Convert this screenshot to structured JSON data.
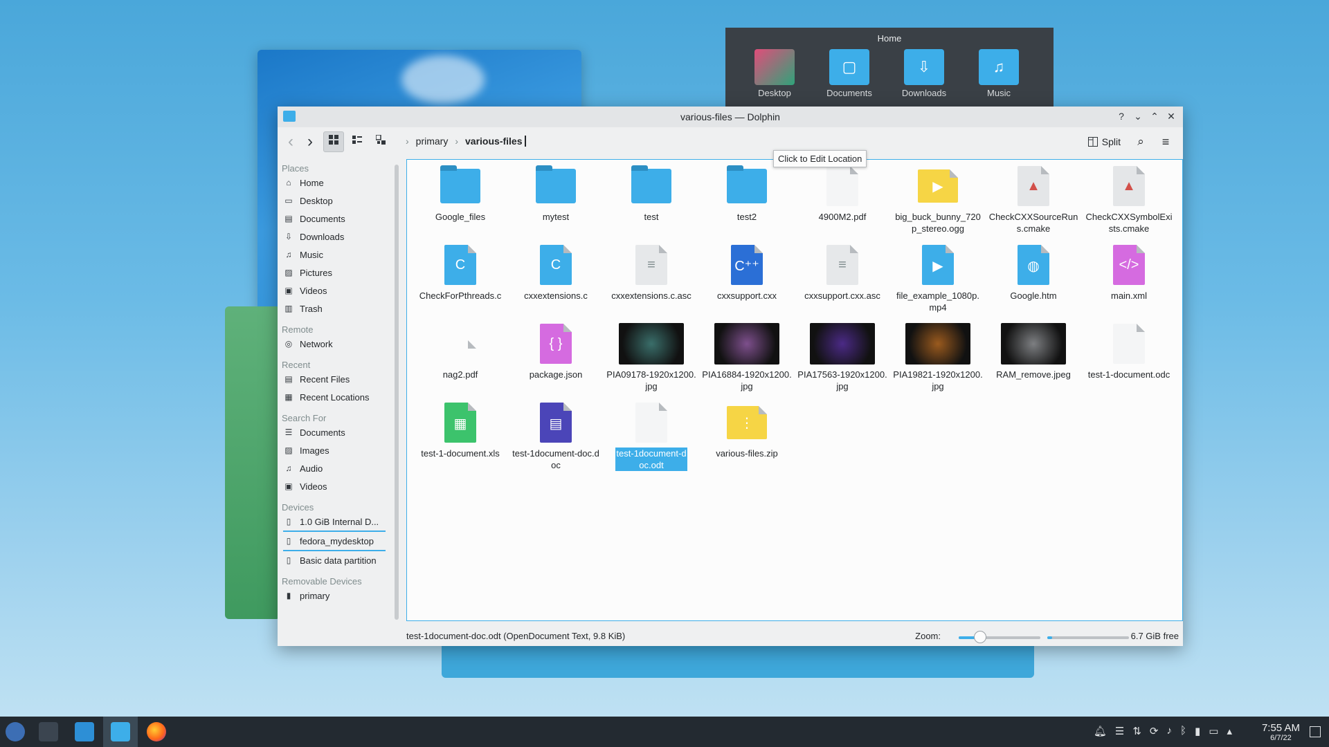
{
  "home_popup": {
    "title": "Home",
    "items": [
      {
        "label": "Desktop",
        "icon": "desktop-folder-icon"
      },
      {
        "label": "Documents",
        "icon": "documents-folder-icon"
      },
      {
        "label": "Downloads",
        "icon": "downloads-folder-icon"
      },
      {
        "label": "Music",
        "icon": "music-folder-icon"
      }
    ]
  },
  "window": {
    "title": "various-files — Dolphin",
    "controls": {
      "help": "?",
      "minimize": "⌄",
      "maximize": "⌃",
      "close": "✕"
    }
  },
  "toolbar": {
    "back": "‹",
    "forward": "›",
    "breadcrumb": [
      "primary",
      "various-files"
    ],
    "split_label": "Split",
    "tooltip": "Click to Edit Location"
  },
  "places": [
    {
      "group": "Places",
      "items": [
        {
          "label": "Home",
          "icon": "home-icon"
        },
        {
          "label": "Desktop",
          "icon": "desktop-icon"
        },
        {
          "label": "Documents",
          "icon": "documents-icon"
        },
        {
          "label": "Downloads",
          "icon": "downloads-icon"
        },
        {
          "label": "Music",
          "icon": "music-icon"
        },
        {
          "label": "Pictures",
          "icon": "pictures-icon"
        },
        {
          "label": "Videos",
          "icon": "videos-icon"
        },
        {
          "label": "Trash",
          "icon": "trash-icon"
        }
      ]
    },
    {
      "group": "Remote",
      "items": [
        {
          "label": "Network",
          "icon": "network-icon"
        }
      ]
    },
    {
      "group": "Recent",
      "items": [
        {
          "label": "Recent Files",
          "icon": "recent-files-icon"
        },
        {
          "label": "Recent Locations",
          "icon": "recent-locations-icon"
        }
      ]
    },
    {
      "group": "Search For",
      "items": [
        {
          "label": "Documents",
          "icon": "documents-search-icon"
        },
        {
          "label": "Images",
          "icon": "images-icon"
        },
        {
          "label": "Audio",
          "icon": "audio-icon"
        },
        {
          "label": "Videos",
          "icon": "videos-search-icon"
        }
      ]
    },
    {
      "group": "Devices",
      "items": [
        {
          "label": "1.0 GiB Internal D...",
          "icon": "drive-icon",
          "usage_bar": true
        },
        {
          "label": "fedora_mydesktop",
          "icon": "drive-icon",
          "usage_bar": true
        },
        {
          "label": "Basic data partition",
          "icon": "drive-locked-icon"
        }
      ]
    },
    {
      "group": "Removable Devices",
      "items": [
        {
          "label": "primary",
          "icon": "usb-drive-icon"
        }
      ]
    }
  ],
  "files": [
    {
      "name": "Google_files",
      "kind": "folder"
    },
    {
      "name": "mytest",
      "kind": "folder"
    },
    {
      "name": "test",
      "kind": "folder"
    },
    {
      "name": "test2",
      "kind": "folder"
    },
    {
      "name": "4900M2.pdf",
      "kind": "pdf"
    },
    {
      "name": "big_buck_bunny_720p_stereo.ogg",
      "kind": "audio",
      "color": "#f6d545"
    },
    {
      "name": "CheckCXXSourceRuns.cmake",
      "kind": "cmake"
    },
    {
      "name": "CheckCXXSymbolExists.cmake",
      "kind": "cmake"
    },
    {
      "name": "CheckForPthreads.c",
      "kind": "c",
      "color": "#3daee9"
    },
    {
      "name": "cxxextensions.c",
      "kind": "c",
      "color": "#3daee9"
    },
    {
      "name": "cxxextensions.c.asc",
      "kind": "text"
    },
    {
      "name": "cxxsupport.cxx",
      "kind": "cxx",
      "color": "#2b6fd6"
    },
    {
      "name": "cxxsupport.cxx.asc",
      "kind": "text"
    },
    {
      "name": "file_example_1080p.mp4",
      "kind": "video",
      "color": "#3daee9"
    },
    {
      "name": "Google.htm",
      "kind": "html",
      "color": "#3daee9"
    },
    {
      "name": "main.xml",
      "kind": "xml",
      "color": "#d56be0"
    },
    {
      "name": "nag2.pdf",
      "kind": "pdf-blank"
    },
    {
      "name": "package.json",
      "kind": "json",
      "color": "#d56be0"
    },
    {
      "name": "PIA09178-1920x1200.jpg",
      "kind": "image",
      "color": "#3a6e6a"
    },
    {
      "name": "PIA16884-1920x1200.jpg",
      "kind": "image",
      "color": "#7d4f8c"
    },
    {
      "name": "PIA17563-1920x1200.jpg",
      "kind": "image",
      "color": "#4b2a86"
    },
    {
      "name": "PIA19821-1920x1200.jpg",
      "kind": "image",
      "color": "#9a5a1e"
    },
    {
      "name": "RAM_remove.jpeg",
      "kind": "image",
      "color": "#7d7f82"
    },
    {
      "name": "test-1-document.odc",
      "kind": "odc"
    },
    {
      "name": "test-1-document.xls",
      "kind": "sheet",
      "color": "#3cc36c"
    },
    {
      "name": "test-1document-doc.doc",
      "kind": "word",
      "color": "#4b45b8"
    },
    {
      "name": "test-1document-doc.odt",
      "kind": "odt",
      "selected": true
    },
    {
      "name": "various-files.zip",
      "kind": "zip",
      "color": "#f6d545"
    }
  ],
  "statusbar": {
    "selection_info": "test-1document-doc.odt (OpenDocument Text, 9.8 KiB)",
    "zoom_label": "Zoom:",
    "zoom_level": 0.25,
    "disk_used_fraction": 0.06,
    "free_space": "6.7 GiB free"
  },
  "taskbar": {
    "time": "7:55 AM",
    "date": "6/7/22",
    "tray_icons": [
      "notifications-icon",
      "rss-icon",
      "network-icon",
      "update-icon",
      "volume-icon",
      "bluetooth-icon",
      "usb-icon",
      "display-icon",
      "expand-tray-icon"
    ]
  }
}
